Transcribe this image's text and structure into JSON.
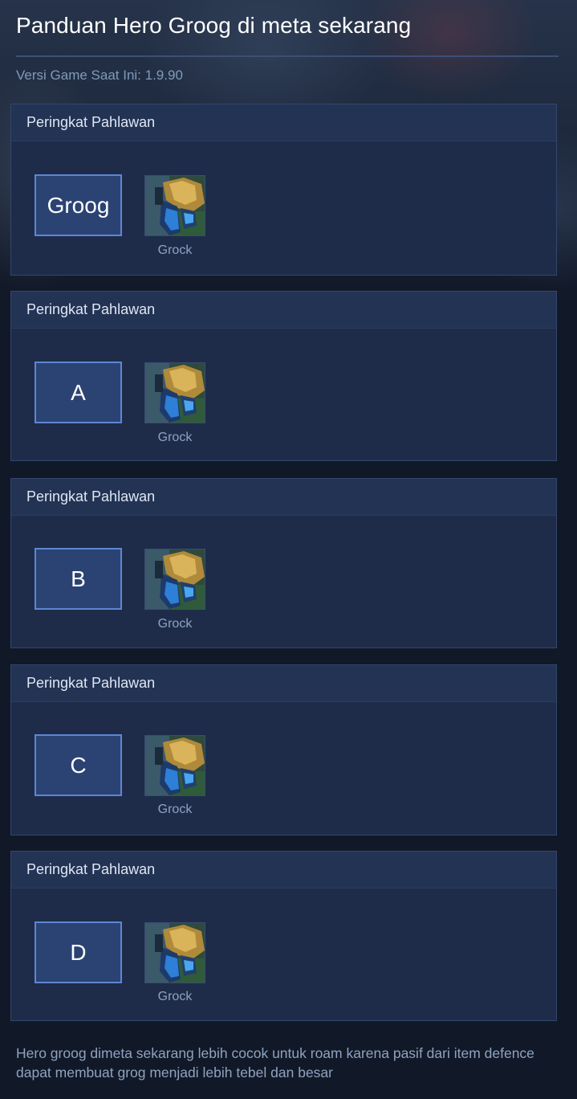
{
  "page": {
    "title": "Panduan Hero Groog di meta sekarang",
    "version_text": "Versi Game Saat Ini: 1.9.90"
  },
  "tiers": [
    {
      "header": "Peringkat Pahlawan",
      "tier": "Groog",
      "hero": {
        "name": "Grock",
        "icon": "grock-portrait-icon"
      }
    },
    {
      "header": "Peringkat Pahlawan",
      "tier": "A",
      "hero": {
        "name": "Grock",
        "icon": "grock-portrait-icon"
      }
    },
    {
      "header": "Peringkat Pahlawan",
      "tier": "B",
      "hero": {
        "name": "Grock",
        "icon": "grock-portrait-icon"
      }
    },
    {
      "header": "Peringkat Pahlawan",
      "tier": "C",
      "hero": {
        "name": "Grock",
        "icon": "grock-portrait-icon"
      }
    },
    {
      "header": "Peringkat Pahlawan",
      "tier": "D",
      "hero": {
        "name": "Grock",
        "icon": "grock-portrait-icon"
      }
    }
  ],
  "footer": {
    "note": "Hero groog dimeta sekarang lebih cocok untuk roam karena pasif dari item defence dapat membuat grog menjadi lebih tebel dan besar"
  },
  "colors": {
    "background": "#111827",
    "card": "#1e2c4a",
    "card_header": "#223354",
    "tier_box": "#2b4373",
    "tier_border": "#5f86d3",
    "muted_text": "#8fa3bd"
  }
}
